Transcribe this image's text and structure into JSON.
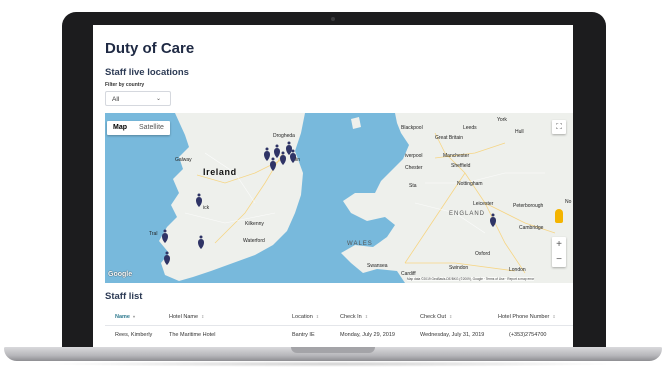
{
  "page": {
    "title": "Duty of Care",
    "section_title": "Staff live locations",
    "filter_label": "Filter by country",
    "filter_value": "All"
  },
  "map": {
    "map_label": "Map",
    "satellite_label": "Satellite",
    "google_label": "Google",
    "attribution": "Map data ©2019 GeoBasis-DE/BKG (©2009), Google · Terms of Use · Report a map error",
    "zoom_in": "+",
    "zoom_out": "−",
    "fullscreen_icon": "fullscreen-icon",
    "water_color": "#78b9dc",
    "land_color": "#eef0ec",
    "marker_color": "#2f3466",
    "places": {
      "ireland": "Ireland",
      "wales": "WALES",
      "england": "ENGLAND",
      "galway": "Galway",
      "limerick": "ick",
      "kilkenny": "Kilkenny",
      "waterford": "Waterford",
      "drogheda": "Drogheda",
      "dublin": "lin",
      "blackpool": "Blackpool",
      "leeds": "Leeds",
      "york": "York",
      "hull": "Hull",
      "liverpool": "iverpool",
      "manchester": "Manchester",
      "sheffield": "Sheffield",
      "nottingham": "Nottingham",
      "leicester": "Leicester",
      "peterborough": "Peterborough",
      "cambridge": "Cambridge",
      "oxford": "Oxford",
      "swindon": "Swindon",
      "london": "London",
      "cardiff": "Cardiff",
      "swansea": "Swansea",
      "chester": "Chester",
      "great_britain": "Great Britain",
      "no": "No",
      "sta": "Sta",
      "tralee": "Tral"
    }
  },
  "staff_list": {
    "title": "Staff list",
    "columns": [
      {
        "label": "Name",
        "sort": "▾"
      },
      {
        "label": "Hotel Name",
        "sort": "⇕"
      },
      {
        "label": "Location",
        "sort": "⇕"
      },
      {
        "label": "Check In",
        "sort": "⇕"
      },
      {
        "label": "Check Out",
        "sort": "⇕"
      },
      {
        "label": "Hotel Phone Number",
        "sort": "⇕"
      }
    ],
    "rows": [
      {
        "name": "Rees, Kimberly",
        "hotel": "The Maritime Hotel",
        "location": "Bantry IE",
        "check_in": "Monday, July 29, 2019",
        "check_out": "Wednesday, July 31, 2019",
        "phone": "(+353)2754700"
      }
    ]
  }
}
